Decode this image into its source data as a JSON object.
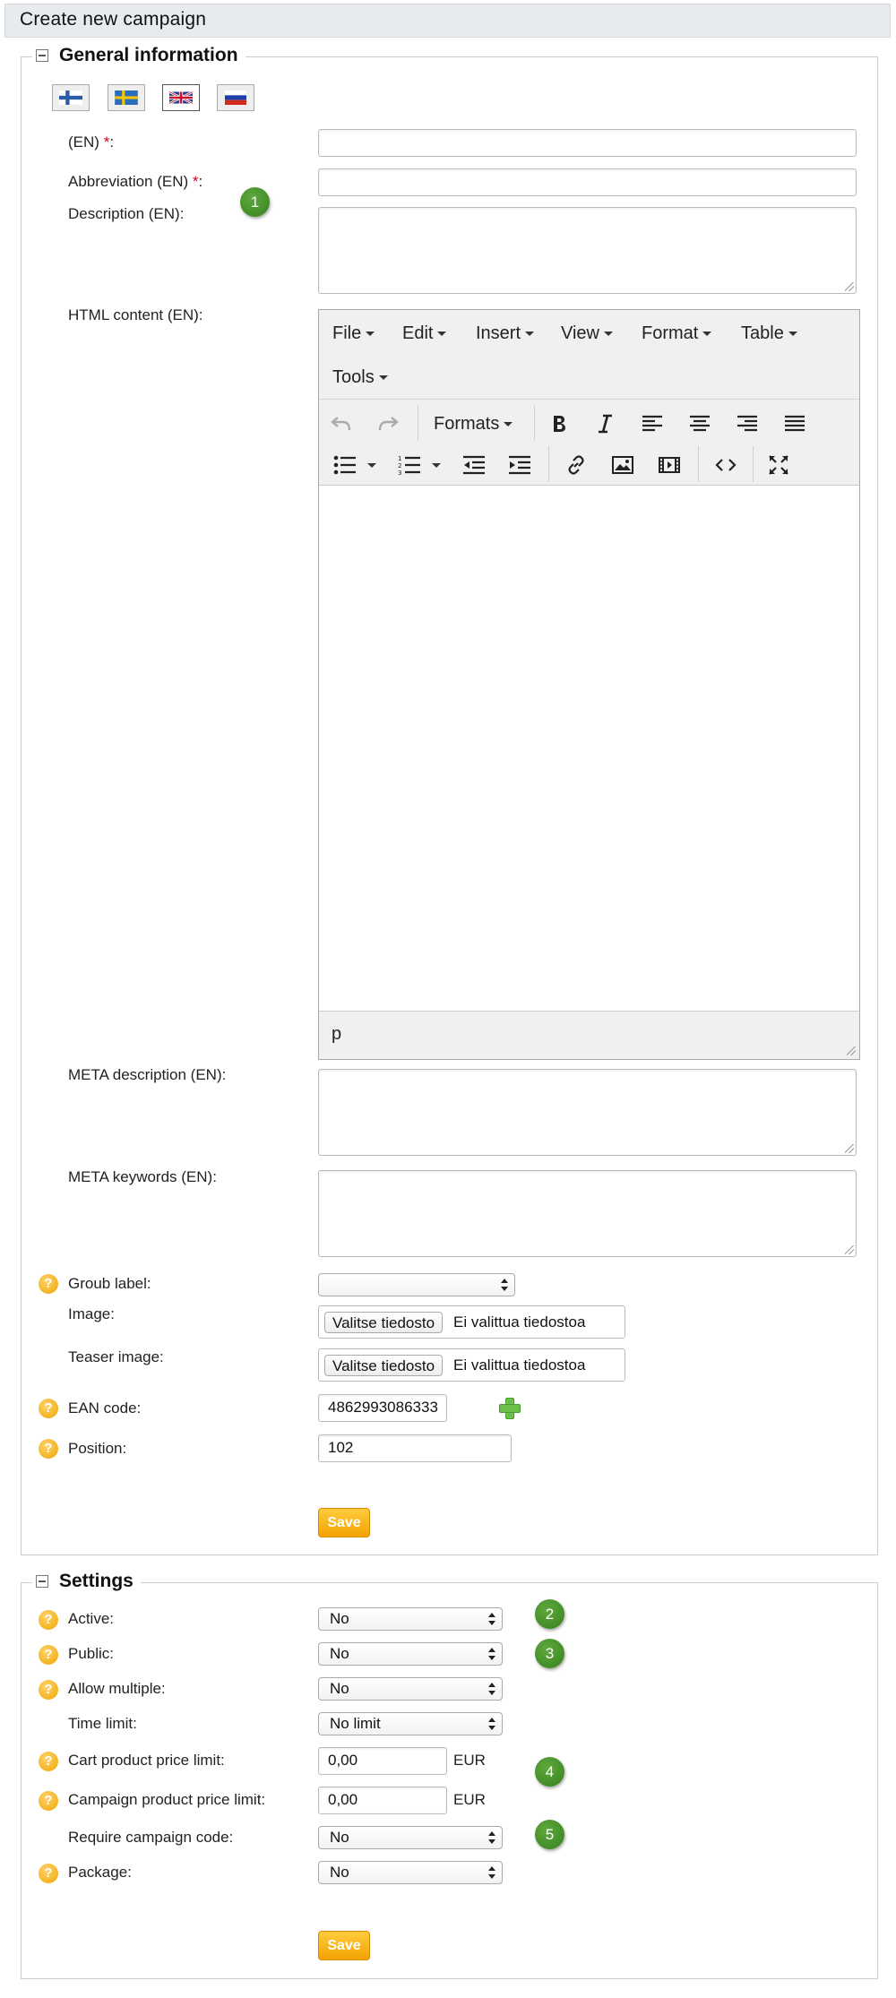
{
  "header": {
    "title": "Create new campaign"
  },
  "general": {
    "legend": "General information",
    "languages": [
      {
        "code": "fi",
        "icon": "flag-finland-icon",
        "active": false
      },
      {
        "code": "sv",
        "icon": "flag-sweden-icon",
        "active": false
      },
      {
        "code": "en",
        "icon": "flag-uk-icon",
        "active": true
      },
      {
        "code": "ru",
        "icon": "flag-russia-icon",
        "active": false
      }
    ],
    "name_label": "(EN)",
    "required_mark": "*",
    "colon": ":",
    "abbreviation_label": "Abbreviation (EN)",
    "description_label": "Description (EN):",
    "html_content_label": "HTML content (EN):",
    "meta_description_label": "META description (EN):",
    "meta_keywords_label": "META keywords (EN):",
    "group_label": "Groub label:",
    "group_value": "",
    "image_label": "Image:",
    "teaser_label": "Teaser image:",
    "file_button": "Valitse tiedosto",
    "file_status": "Ei valittua tiedostoa",
    "ean_label": "EAN code:",
    "ean_value": "4862993086333",
    "position_label": "Position:",
    "position_value": "102",
    "save_label": "Save"
  },
  "editor": {
    "menus": [
      "File",
      "Edit",
      "Insert",
      "View",
      "Format",
      "Table",
      "Tools"
    ],
    "formats_label": "Formats",
    "status_path": "p"
  },
  "settings": {
    "legend": "Settings",
    "active_label": "Active:",
    "active_value": "No",
    "public_label": "Public:",
    "public_value": "No",
    "allow_multiple_label": "Allow multiple:",
    "allow_multiple_value": "No",
    "time_limit_label": "Time limit:",
    "time_limit_value": "No limit",
    "cart_limit_label": "Cart product price limit:",
    "cart_limit_value": "0,00",
    "campaign_limit_label": "Campaign product price limit:",
    "campaign_limit_value": "0,00",
    "currency": "EUR",
    "require_code_label": "Require campaign code:",
    "require_code_value": "No",
    "package_label": "Package:",
    "package_value": "No",
    "save_label": "Save"
  },
  "annotations": [
    "1",
    "2",
    "3",
    "4",
    "5"
  ],
  "help_glyph": "?",
  "colors": {
    "accent": "#f3a200",
    "badge": "#3f8a26",
    "header_bg": "#e8ebee"
  }
}
